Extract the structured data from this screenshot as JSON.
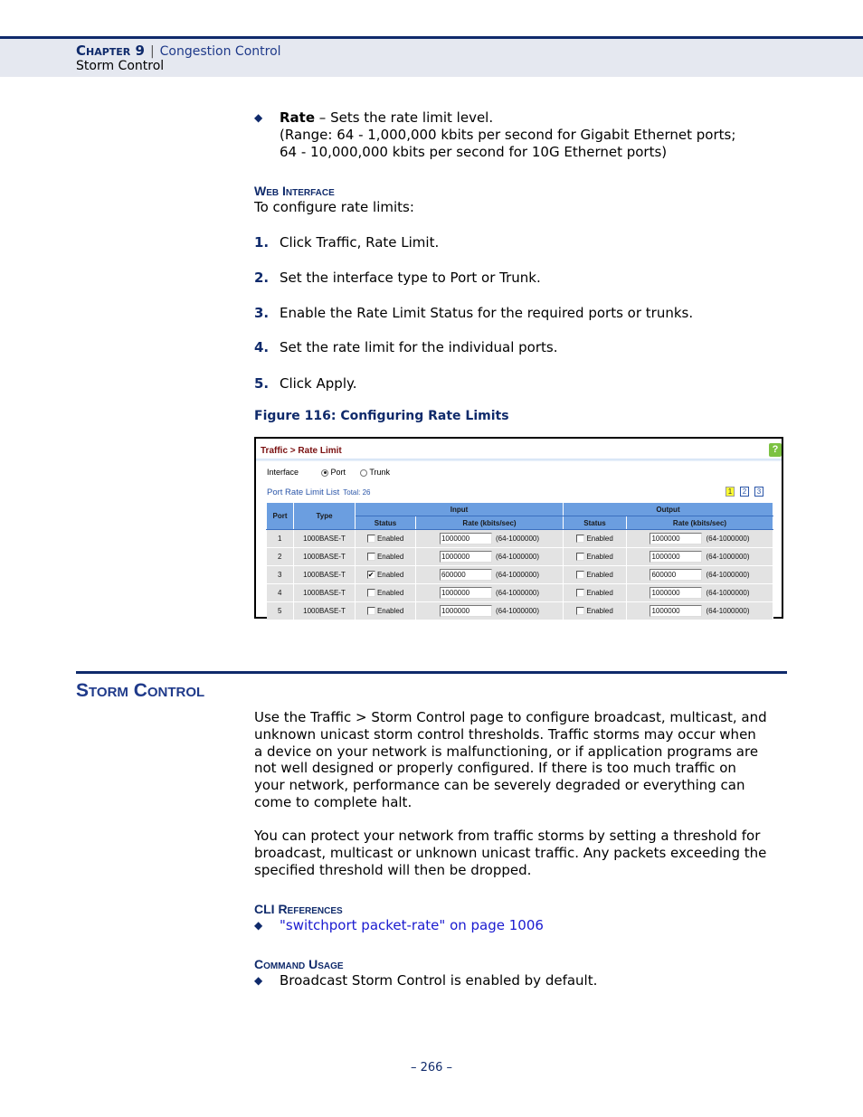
{
  "header": {
    "chapter": "Chapter 9",
    "separator": "|",
    "chapter_title": "Congestion Control",
    "section": "Storm Control"
  },
  "rate_bullet": {
    "term": "Rate",
    "desc": " – Sets the rate limit level.",
    "line2": "(Range: 64 - 1,000,000 kbits per second for Gigabit Ethernet ports;",
    "line3": "64 - 10,000,000 kbits per second for 10G Ethernet ports)"
  },
  "web_interface": {
    "heading": "Web Interface",
    "intro": "To configure rate limits:",
    "steps": [
      {
        "num": "1.",
        "text": "Click Traffic, Rate Limit."
      },
      {
        "num": "2.",
        "text": "Set the interface type to Port or Trunk."
      },
      {
        "num": "3.",
        "text": "Enable the Rate Limit Status for the required ports or trunks."
      },
      {
        "num": "4.",
        "text": "Set the rate limit for the individual ports."
      },
      {
        "num": "5.",
        "text": "Click Apply."
      }
    ]
  },
  "figure": {
    "caption": "Figure 116:  Configuring Rate Limits",
    "breadcrumb": "Traffic > Rate Limit",
    "help_icon": "?",
    "interface_label": "Interface",
    "interface_options": [
      "Port",
      "Trunk"
    ],
    "interface_selected": "Port",
    "list_title": "Port Rate Limit List",
    "list_total": "Total: 26",
    "pages": [
      "1",
      "2",
      "3"
    ],
    "current_page": "1",
    "columns": {
      "port": "Port",
      "type": "Type",
      "input": "Input",
      "output": "Output",
      "status": "Status",
      "rate": "Rate (kbits/sec)"
    },
    "checkbox_label": "Enabled",
    "range_hint": "(64-1000000)",
    "rows": [
      {
        "port": "1",
        "type": "1000BASE-T",
        "in_enabled": false,
        "in_rate": "1000000",
        "out_enabled": false,
        "out_rate": "1000000"
      },
      {
        "port": "2",
        "type": "1000BASE-T",
        "in_enabled": false,
        "in_rate": "1000000",
        "out_enabled": false,
        "out_rate": "1000000"
      },
      {
        "port": "3",
        "type": "1000BASE-T",
        "in_enabled": true,
        "in_rate": "600000",
        "out_enabled": false,
        "out_rate": "600000"
      },
      {
        "port": "4",
        "type": "1000BASE-T",
        "in_enabled": false,
        "in_rate": "1000000",
        "out_enabled": false,
        "out_rate": "1000000"
      },
      {
        "port": "5",
        "type": "1000BASE-T",
        "in_enabled": false,
        "in_rate": "1000000",
        "out_enabled": false,
        "out_rate": "1000000"
      }
    ]
  },
  "storm_control": {
    "heading": "Storm Control",
    "para1": [
      "Use the Traffic > Storm Control page to configure broadcast, multicast, and",
      "unknown unicast storm control thresholds. Traffic storms may occur when",
      "a device on your network is malfunctioning, or if application programs are",
      "not well designed or properly configured. If there is too much traffic on",
      "your network, performance can be severely degraded or everything can",
      "come to complete halt."
    ],
    "para2": [
      "You can protect your network from traffic storms by setting a threshold for",
      "broadcast, multicast or unknown unicast traffic. Any packets exceeding the",
      "specified threshold will then be dropped."
    ],
    "cli_heading": "CLI References",
    "cli_link": "\"switchport packet-rate\" on page 1006",
    "usage_heading": "Command Usage",
    "usage_item": "Broadcast Storm Control is enabled by default."
  },
  "footer": {
    "page": "–  266  –"
  }
}
